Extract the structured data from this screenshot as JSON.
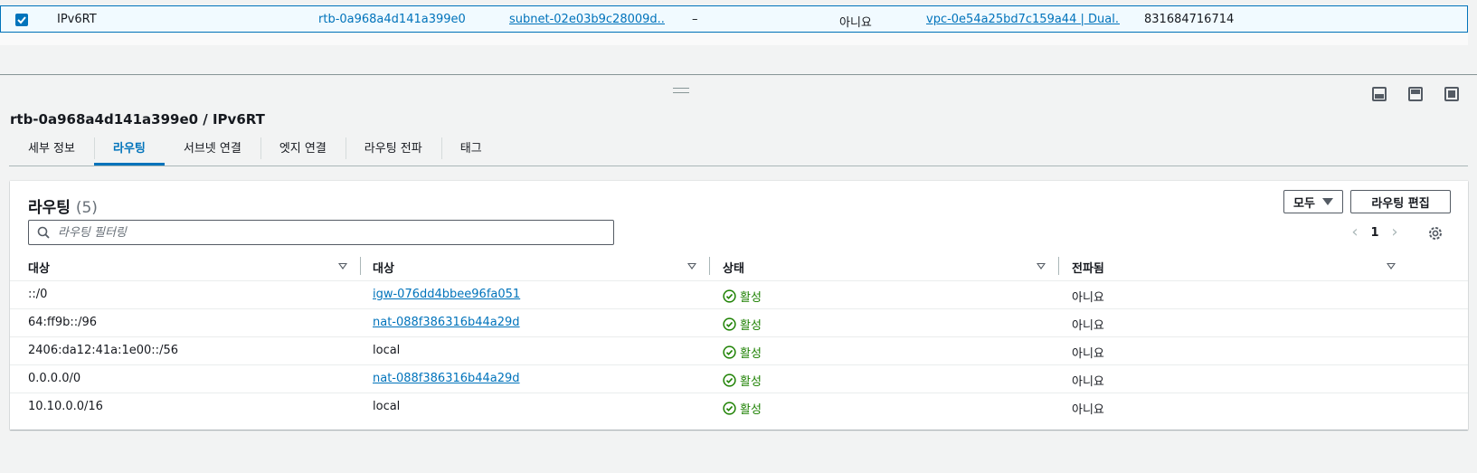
{
  "top_row": {
    "name": "IPv6RT",
    "route_table_id": "rtb-0a968a4d141a399e0",
    "subnet": "subnet-02e03b9c28009d...",
    "edge": "–",
    "main": "아니요",
    "vpc": "vpc-0e54a25bd7c159a44 | Dual...",
    "owner": "831684716714"
  },
  "panel": {
    "title": "rtb-0a968a4d141a399e0 / IPv6RT",
    "tabs": [
      "세부 정보",
      "라우팅",
      "서브넷 연결",
      "엣지 연결",
      "라우팅 전파",
      "태그"
    ],
    "active_tab": "라우팅"
  },
  "routes": {
    "title": "라우팅",
    "count": "(5)",
    "filter_button": "모두",
    "edit_button": "라우팅 편집",
    "search_placeholder": "라우팅 필터링",
    "page": "1",
    "columns": [
      "대상",
      "대상",
      "상태",
      "전파됨"
    ],
    "rows": [
      {
        "destination": "::/0",
        "target": "igw-076dd4bbee96fa051",
        "target_link": true,
        "status": "활성",
        "propagated": "아니요"
      },
      {
        "destination": "64:ff9b::/96",
        "target": "nat-088f386316b44a29d",
        "target_link": true,
        "status": "활성",
        "propagated": "아니요"
      },
      {
        "destination": "2406:da12:41a:1e00::/56",
        "target": "local",
        "target_link": false,
        "status": "활성",
        "propagated": "아니요"
      },
      {
        "destination": "0.0.0.0/0",
        "target": "nat-088f386316b44a29d",
        "target_link": true,
        "status": "활성",
        "propagated": "아니요"
      },
      {
        "destination": "10.10.0.0/16",
        "target": "local",
        "target_link": false,
        "status": "활성",
        "propagated": "아니요"
      }
    ]
  },
  "colors": {
    "accent": "#0073bb",
    "success": "#1d8102",
    "border": "#aab7b8"
  }
}
